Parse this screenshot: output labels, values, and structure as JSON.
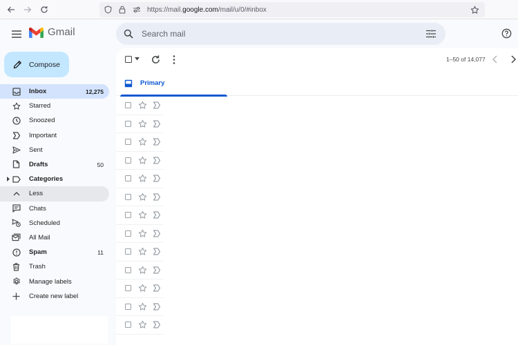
{
  "browser": {
    "url_prefix": "https://mail.",
    "url_domain": "google.com",
    "url_path": "/mail/u/0/#inbox"
  },
  "header": {
    "logo_text": "Gmail",
    "search_placeholder": "Search mail"
  },
  "compose": {
    "label": "Compose"
  },
  "sidebar": {
    "items": [
      {
        "label": "Inbox",
        "count": "12,275"
      },
      {
        "label": "Starred",
        "count": ""
      },
      {
        "label": "Snoozed",
        "count": ""
      },
      {
        "label": "Important",
        "count": ""
      },
      {
        "label": "Sent",
        "count": ""
      },
      {
        "label": "Drafts",
        "count": "50"
      },
      {
        "label": "Categories",
        "count": ""
      },
      {
        "label": "Less",
        "count": ""
      },
      {
        "label": "Chats",
        "count": ""
      },
      {
        "label": "Scheduled",
        "count": ""
      },
      {
        "label": "All Mail",
        "count": ""
      },
      {
        "label": "Spam",
        "count": "11"
      },
      {
        "label": "Trash",
        "count": ""
      },
      {
        "label": "Manage labels",
        "count": ""
      },
      {
        "label": "Create new label",
        "count": ""
      }
    ]
  },
  "toolbar": {
    "pagination": "1–50 of 14,077"
  },
  "tabs": {
    "primary": "Primary"
  },
  "colors": {
    "accent": "#0b57d0",
    "compose_bg": "#c2e7ff",
    "active_nav_bg": "#d3e3fd"
  }
}
